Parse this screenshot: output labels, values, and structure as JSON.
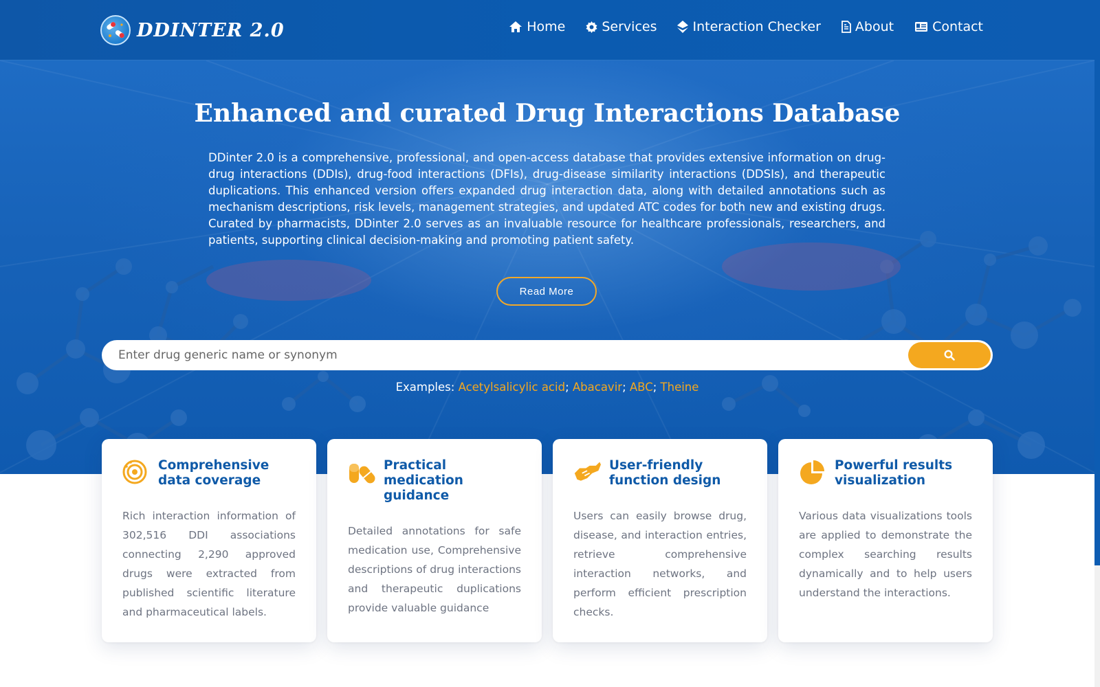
{
  "brand": {
    "name": "DDINTER 2.0",
    "logo_icon": "pill-capsule-icon"
  },
  "nav": [
    {
      "label": "Home",
      "icon": "home-icon"
    },
    {
      "label": "Services",
      "icon": "gear-icon"
    },
    {
      "label": "Interaction Checker",
      "icon": "diamond-icon"
    },
    {
      "label": "About",
      "icon": "document-icon"
    },
    {
      "label": "Contact",
      "icon": "contact-card-icon"
    }
  ],
  "hero": {
    "title": "Enhanced and curated Drug Interactions Database",
    "description": "DDinter 2.0 is a comprehensive, professional, and open-access database that provides extensive information on drug-drug interactions (DDIs), drug-food interactions (DFIs), drug-disease similarity interactions (DDSIs), and therapeutic duplications. This enhanced version offers expanded drug interaction data, along with detailed annotations such as mechanism descriptions, risk levels, management strategies, and updated ATC codes for both new and existing drugs. Curated by pharmacists, DDinter 2.0 serves as an invaluable resource for healthcare professionals, researchers, and patients, supporting clinical decision-making and promoting patient safety.",
    "read_more_label": "Read More"
  },
  "search": {
    "placeholder": "Enter drug generic name or synonym",
    "value": "",
    "button_icon": "search-icon"
  },
  "examples": {
    "label": "Examples:",
    "items": [
      "Acetylsalicylic acid",
      "Abacavir",
      "ABC",
      "Theine"
    ],
    "separator": ";"
  },
  "features": [
    {
      "title": "Comprehensive data coverage",
      "icon": "target-icon",
      "text": "Rich interaction information of 302,516 DDI associations connecting 2,290 approved drugs were extracted from published scientific literature and pharmaceutical labels."
    },
    {
      "title": "Practical medication guidance",
      "icon": "pills-icon",
      "text": "Detailed annotations for safe medication use, Comprehensive descriptions of drug interactions and therapeutic duplications provide valuable guidance"
    },
    {
      "title": "User-friendly function design",
      "icon": "handshake-icon",
      "text": "Users can easily browse drug, disease, and interaction entries, retrieve comprehensive interaction networks, and perform efficient prescription checks."
    },
    {
      "title": "Powerful results visualization",
      "icon": "pie-chart-icon",
      "text": "Various data visualizations tools are applied to demonstrate the complex searching results dynamically and to help users understand the interactions."
    }
  ],
  "colors": {
    "primary": "#0e57a8",
    "accent": "#f4a81f",
    "card_title": "#0f5aa8",
    "card_text": "#6d7381"
  }
}
